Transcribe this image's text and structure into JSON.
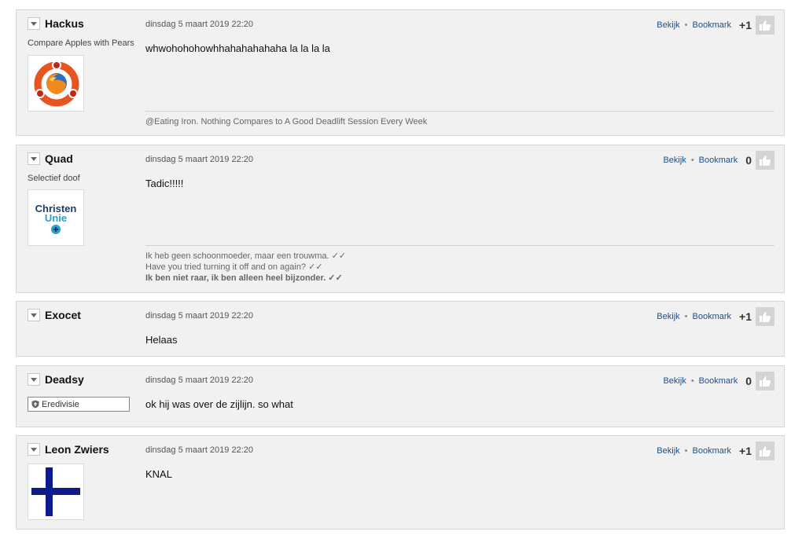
{
  "actions": {
    "view_label": "Bekijk",
    "separator": "•",
    "bookmark_label": "Bookmark"
  },
  "posts": [
    {
      "username": "Hackus",
      "user_title": "Compare Apples with Pears",
      "date": "dinsdag 5 maart 2019 22:20",
      "message": "whwohohohowhhahahahahaha la la la la",
      "score": "+1",
      "signature": [
        "@Eating Iron. Nothing Compares to A Good Deadlift Session Every Week"
      ]
    },
    {
      "username": "Quad",
      "user_title": "Selectief doof",
      "avatar_text": {
        "line1": "Christen",
        "line2": "Unie"
      },
      "date": "dinsdag 5 maart 2019 22:20",
      "message": "Tadic!!!!!",
      "score": "0",
      "signature": [
        "Ik heb geen schoonmoeder, maar een trouwma. ✓✓",
        "Have you tried turning it off and on again? ✓✓",
        "Ik ben niet raar, ik ben alleen heel bijzonder. ✓✓"
      ]
    },
    {
      "username": "Exocet",
      "date": "dinsdag 5 maart 2019 22:20",
      "message": "Helaas",
      "score": "+1"
    },
    {
      "username": "Deadsy",
      "badge": "Eredivisie",
      "date": "dinsdag 5 maart 2019 22:20",
      "message": "ok hij was over de zijlijn. so what",
      "score": "0"
    },
    {
      "username": "Leon Zwiers",
      "date": "dinsdag 5 maart 2019 22:20",
      "message": "KNAL",
      "score": "+1"
    }
  ],
  "icons": {
    "toggle": "chevron-down-icon",
    "like": "thumbs-up-icon",
    "badge": "shield-icon"
  },
  "colors": {
    "post_background": "#f1f1f1",
    "link": "#1d4f8a",
    "like_button": "#d4d4d4",
    "christenunie_blue": "#1b3d6e",
    "christenunie_teal": "#2aa0c8",
    "cross_navy": "#0d1b8c",
    "ubuntu_orange": "#e8541f"
  }
}
